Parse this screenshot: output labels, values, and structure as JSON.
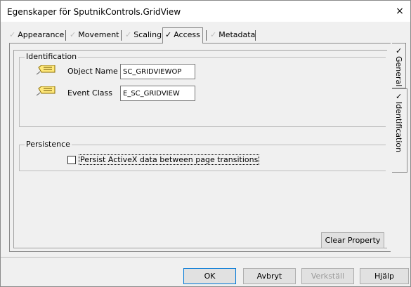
{
  "window": {
    "title": "Egenskaper för SputnikControls.GridView",
    "close_glyph": "×"
  },
  "tabs": [
    {
      "label": "Appearance",
      "checked": false
    },
    {
      "label": "Movement",
      "checked": false
    },
    {
      "label": "Scaling",
      "checked": false
    },
    {
      "label": "Access",
      "checked": true,
      "active": true
    },
    {
      "label": "Metadata",
      "checked": false
    }
  ],
  "side_tabs": [
    {
      "label": "General",
      "checked": true
    },
    {
      "label": "Identification",
      "checked": true,
      "active": true
    }
  ],
  "identification": {
    "legend": "Identification",
    "object_name_label": "Object Name",
    "object_name_value": "SC_GRIDVIEWOP",
    "event_class_label": "Event Class",
    "event_class_value": "E_SC_GRIDVIEW"
  },
  "persistence": {
    "legend": "Persistence",
    "checkbox_label": "Persist ActiveX data between page transitions",
    "checked": false
  },
  "clear_property_label": "Clear Property",
  "footer": {
    "ok_label": "OK",
    "cancel_label": "Avbryt",
    "apply_label": "Verkställ",
    "help_label": "Hjälp"
  },
  "icons": {
    "property": "property-tag-icon",
    "check": "✓"
  },
  "colors": {
    "window_bg": "#f0f0f0",
    "titlebar_bg": "#ffffff",
    "default_button_border": "#0078d7"
  }
}
